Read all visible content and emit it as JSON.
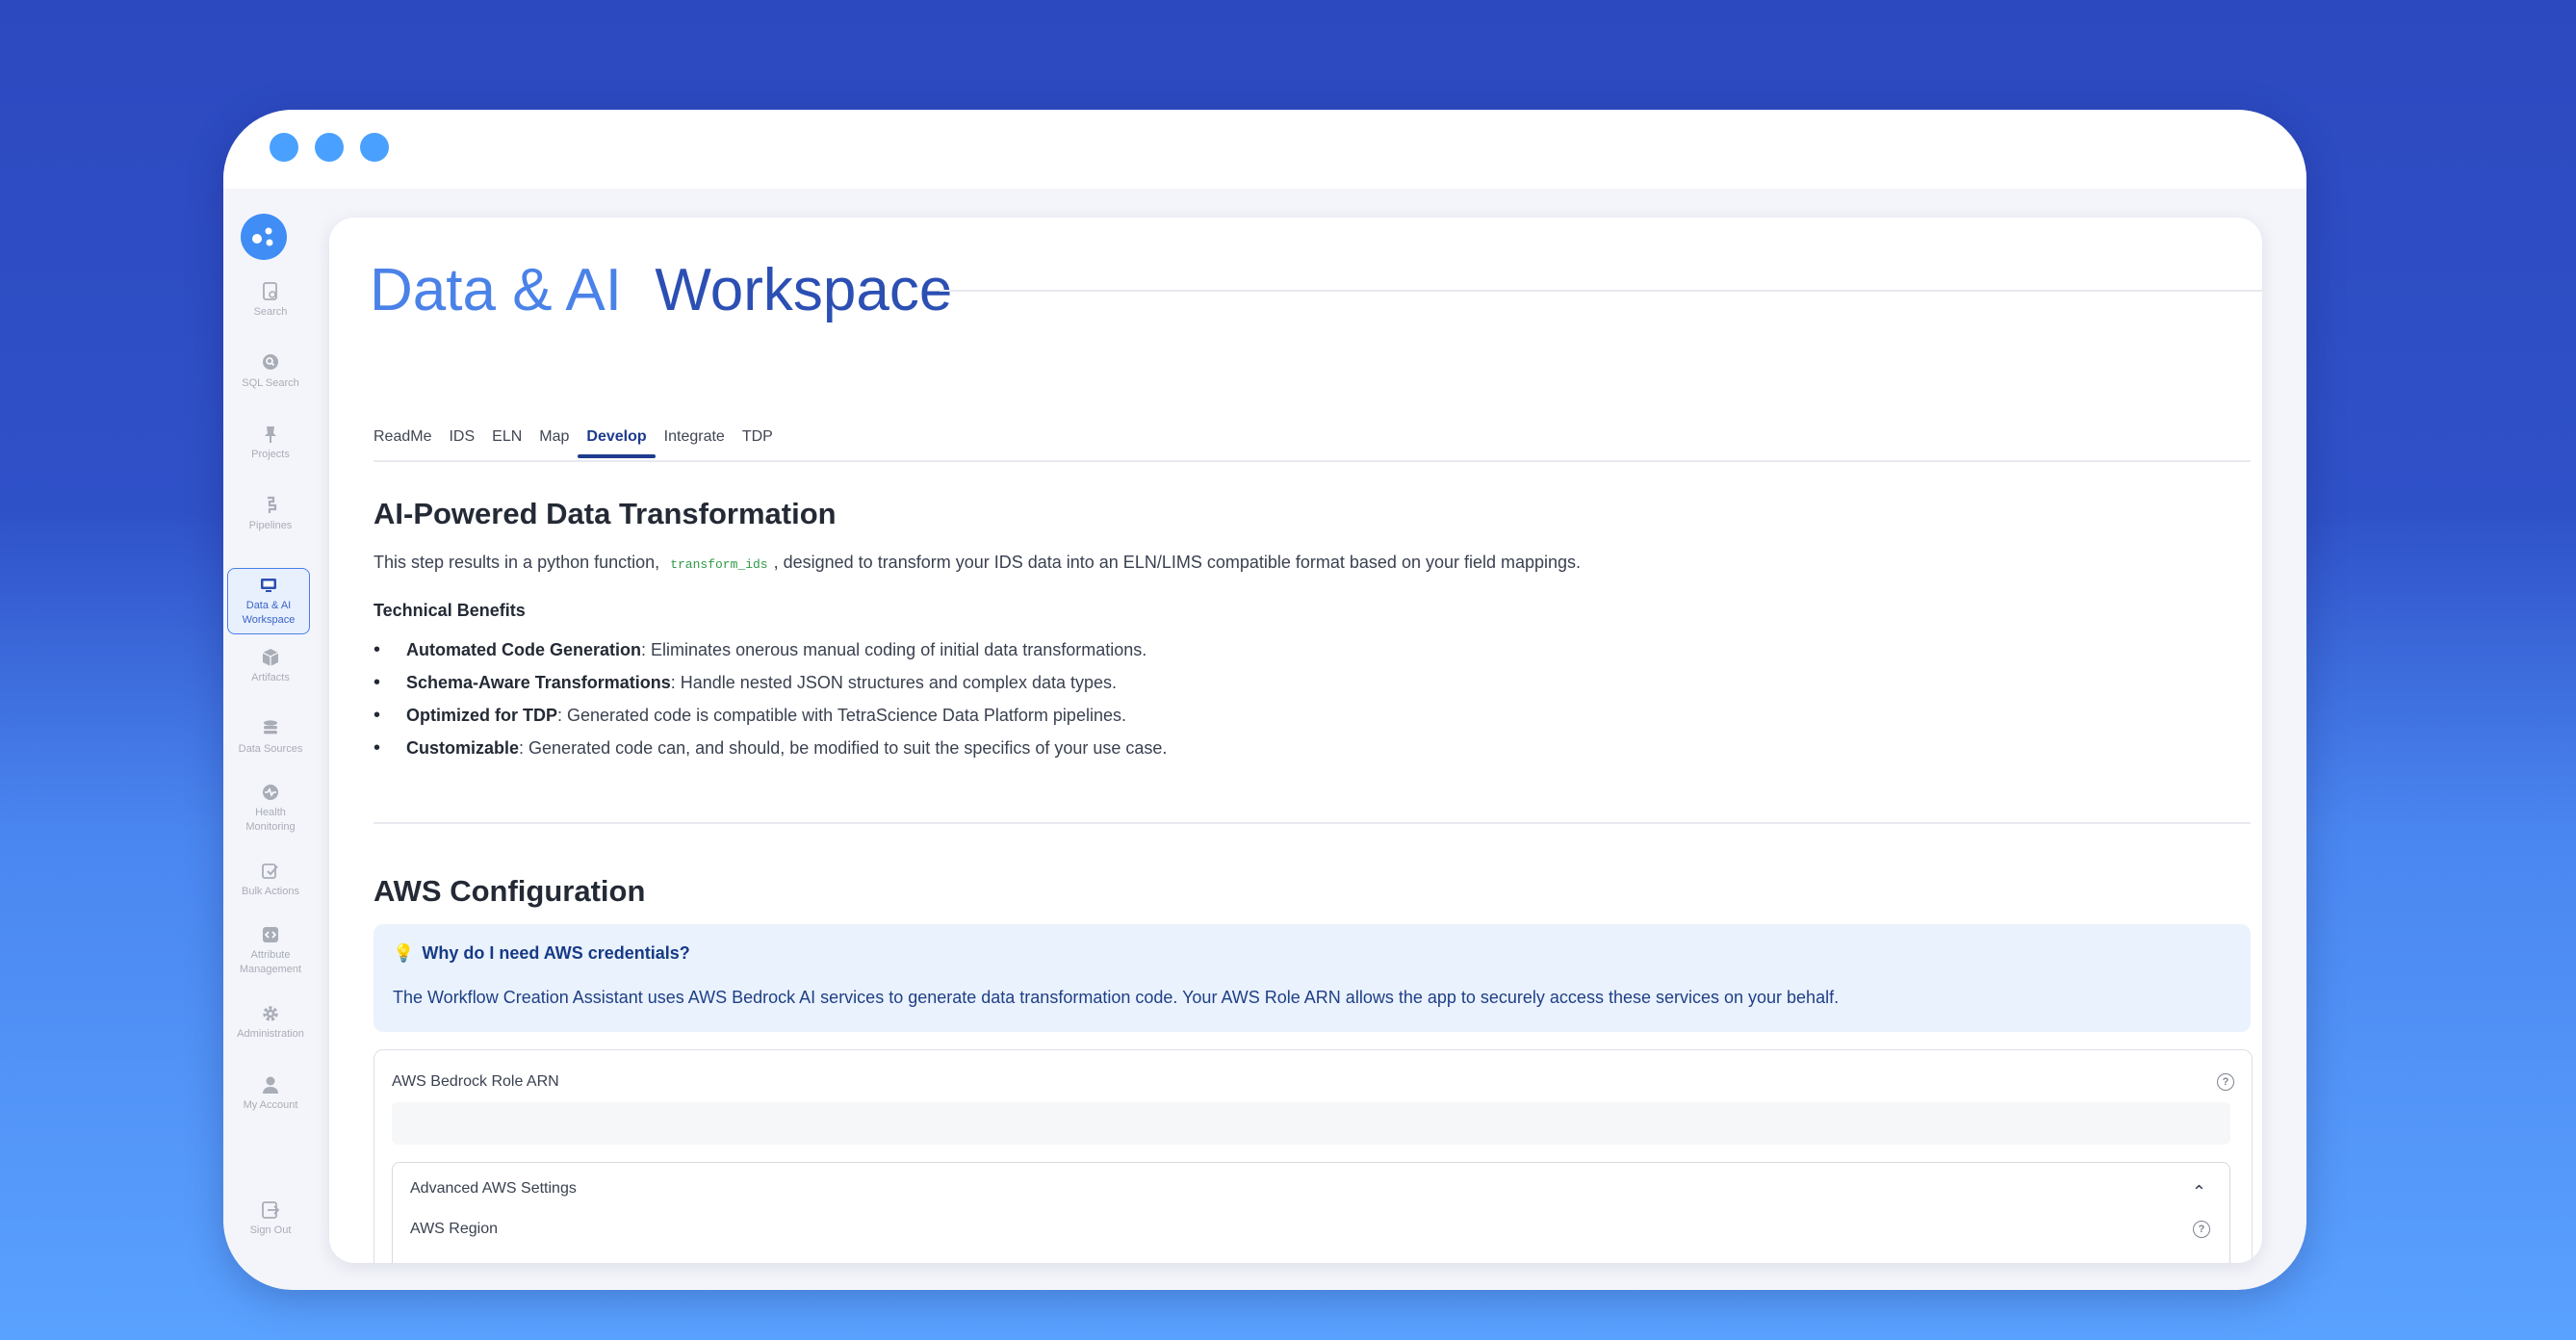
{
  "sidebar": {
    "items": [
      {
        "label": "Search",
        "icon": "document-search-icon"
      },
      {
        "label": "SQL Search",
        "icon": "sql-search-icon"
      },
      {
        "label": "Projects",
        "icon": "pin-icon"
      },
      {
        "label": "Pipelines",
        "icon": "pipeline-icon"
      },
      {
        "label": "Data & AI Workspace",
        "icon": "monitor-icon"
      },
      {
        "label": "Artifacts",
        "icon": "cube-icon"
      },
      {
        "label": "Data Sources",
        "icon": "database-icon"
      },
      {
        "label": "Health Monitoring",
        "icon": "health-icon"
      },
      {
        "label": "Bulk Actions",
        "icon": "checklist-icon"
      },
      {
        "label": "Attribute Management",
        "icon": "code-icon"
      },
      {
        "label": "Administration",
        "icon": "gear-icon"
      },
      {
        "label": "My Account",
        "icon": "user-icon"
      },
      {
        "label": "Sign Out",
        "icon": "sign-out-icon"
      }
    ]
  },
  "header": {
    "title_part1": "Data & AI",
    "title_part2": "Workspace"
  },
  "tabs": [
    "ReadMe",
    "IDS",
    "ELN",
    "Map",
    "Develop",
    "Integrate",
    "TDP"
  ],
  "active_tab": "Develop",
  "transform": {
    "heading": "AI-Powered Data Transformation",
    "intro_before": "This step results in a python function,",
    "code": "transform_ids",
    "intro_after": ", designed to transform your IDS data into an ELN/LIMS compatible format based on your field mappings.",
    "benefits_title": "Technical Benefits",
    "benefits": [
      {
        "bold": "Automated Code Generation",
        "text": ": Eliminates onerous manual coding of initial data transformations."
      },
      {
        "bold": "Schema-Aware Transformations",
        "text": ": Handle nested JSON structures and complex data types."
      },
      {
        "bold": "Optimized for TDP",
        "text": ": Generated code is compatible with TetraScience Data Platform pipelines."
      },
      {
        "bold": "Customizable",
        "text": ": Generated code can, and should, be modified to suit the specifics of your use case."
      }
    ]
  },
  "aws": {
    "heading": "AWS Configuration",
    "info_question": "Why do I need AWS credentials?",
    "info_text": "The Workflow Creation Assistant uses AWS Bedrock AI services to generate data transformation code. Your AWS Role ARN allows the app to securely access these services on your behalf.",
    "role_label": "AWS Bedrock Role ARN",
    "role_value": "",
    "advanced_title": "Advanced AWS Settings",
    "region_label": "AWS Region",
    "help_glyph": "?",
    "chevron_glyph": "⌃",
    "bulb_glyph": "💡"
  },
  "colors": {
    "accent": "#2b4fb3",
    "title_light": "#4a82e8",
    "code_green": "#2f9a48",
    "info_bg": "#eaf2fd"
  }
}
